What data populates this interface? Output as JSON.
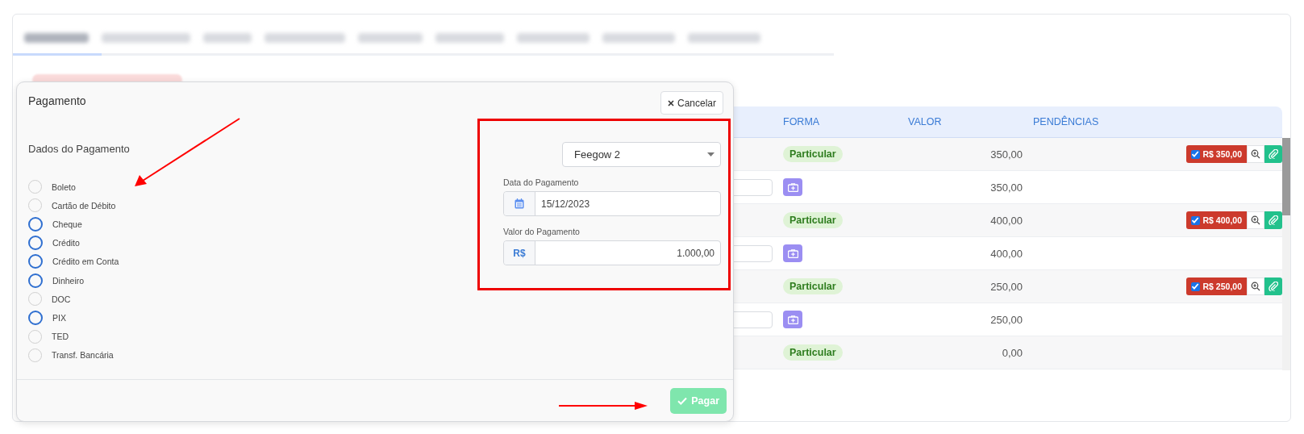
{
  "tabs": [
    {
      "selected": true
    },
    {
      "selected": false
    },
    {
      "selected": false
    },
    {
      "selected": false
    },
    {
      "selected": false
    },
    {
      "selected": false
    },
    {
      "selected": false
    },
    {
      "selected": false
    },
    {
      "selected": false
    }
  ],
  "table": {
    "columns": [
      "FORMA",
      "VALOR",
      "PENDÊNCIAS"
    ],
    "rows": [
      {
        "kind": "charge",
        "forma": "Particular",
        "valor": "350,00",
        "pendencia": {
          "checked": true,
          "amount": "R$ 350,00"
        }
      },
      {
        "kind": "detail",
        "valor": "350,00"
      },
      {
        "kind": "charge",
        "forma": "Particular",
        "valor": "400,00",
        "pendencia": {
          "checked": true,
          "amount": "R$ 400,00"
        }
      },
      {
        "kind": "detail",
        "valor": "400,00"
      },
      {
        "kind": "charge",
        "forma": "Particular",
        "valor": "250,00",
        "pendencia": {
          "checked": true,
          "amount": "R$ 250,00"
        }
      },
      {
        "kind": "detail",
        "valor": "250,00"
      },
      {
        "kind": "charge",
        "forma": "Particular",
        "valor": "0,00"
      }
    ]
  },
  "modal": {
    "title": "Pagamento",
    "cancel": "Cancelar",
    "section": "Dados do Pagamento",
    "methods": [
      {
        "label": "Boleto",
        "active": false
      },
      {
        "label": "Cartão de Débito",
        "active": false
      },
      {
        "label": "Cheque",
        "active": true
      },
      {
        "label": "Crédito",
        "active": true
      },
      {
        "label": "Crédito em Conta",
        "active": true
      },
      {
        "label": "Dinheiro",
        "active": true
      },
      {
        "label": "DOC",
        "active": false
      },
      {
        "label": "PIX",
        "active": true
      },
      {
        "label": "TED",
        "active": false
      },
      {
        "label": "Transf. Bancária",
        "active": false
      }
    ],
    "account": "Feegow 2",
    "date_label": "Data do Pagamento",
    "date": "15/12/2023",
    "amount_label": "Valor do Pagamento",
    "currency": "R$",
    "amount": "1.000,00",
    "submit": "Pagar",
    "submit_disabled": true
  }
}
